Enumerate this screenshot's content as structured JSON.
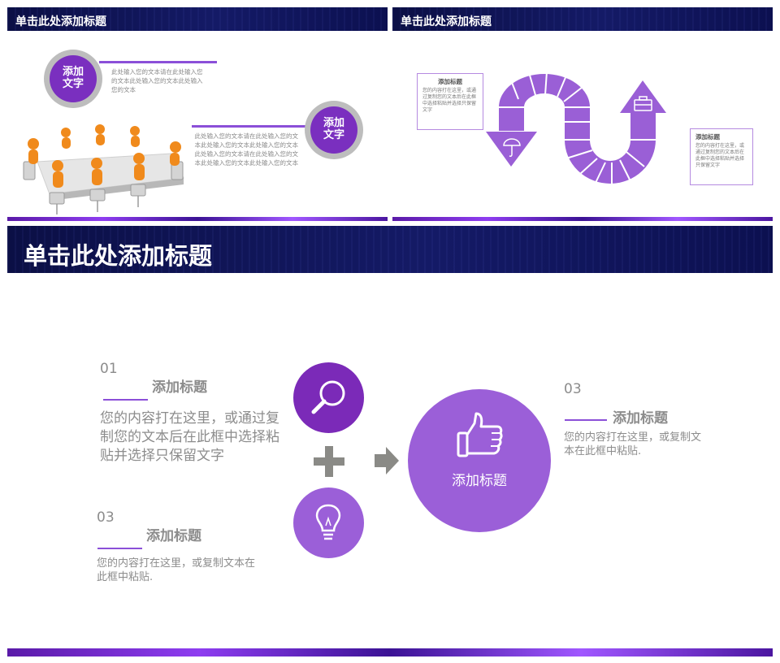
{
  "slide1": {
    "title": "单击此处添加标题",
    "badge1": {
      "line1": "添加",
      "line2": "文字"
    },
    "badge2": {
      "line1": "添加",
      "line2": "文字"
    },
    "text1": "此处输入您的文本请在此处输入您的文本此处输入您的文本此处输入您的文本",
    "text2": "此处输入您的文本请在此处输入您的文本此处输入您的文本此处输入您的文本此处输入您的文本请在此处输入您的文本此处输入您的文本此处输入您的文本"
  },
  "slide2": {
    "title": "单击此处添加标题",
    "callout_left": {
      "title": "添加标题",
      "text": "您的内容打在这里，或通过复制您的文本后在此框中选择粘贴并选择只保留文字"
    },
    "callout_right": {
      "title": "添加标题",
      "text": "您的内容打在这里，或通过复制您的文本后在此框中选择粘贴并选择只保留文字"
    },
    "icons": [
      "umbrella-icon",
      "briefcase-icon"
    ]
  },
  "slide3": {
    "title": "单击此处添加标题",
    "item1": {
      "num": "01",
      "title": "添加标题",
      "text": "您的内容打在这里，或通过复制您的文本后在此框中选择粘贴并选择只保留文字"
    },
    "item2": {
      "num": "03",
      "title": "添加标题",
      "text": "您的内容打在这里，或复制文本在此框中粘贴."
    },
    "item3": {
      "num": "03",
      "title": "添加标题",
      "text": "您的内容打在这里，或复制文本在此框中粘贴."
    },
    "center_label": "添加标题",
    "icons": [
      "magnifier-icon",
      "plus-icon",
      "lightbulb-icon",
      "arrow-right-icon",
      "thumbs-up-icon"
    ]
  },
  "colors": {
    "navy": "#0f1457",
    "purple": "#7a2fbf",
    "light_purple": "#9f6ad9",
    "grey": "#8c8c8c"
  }
}
